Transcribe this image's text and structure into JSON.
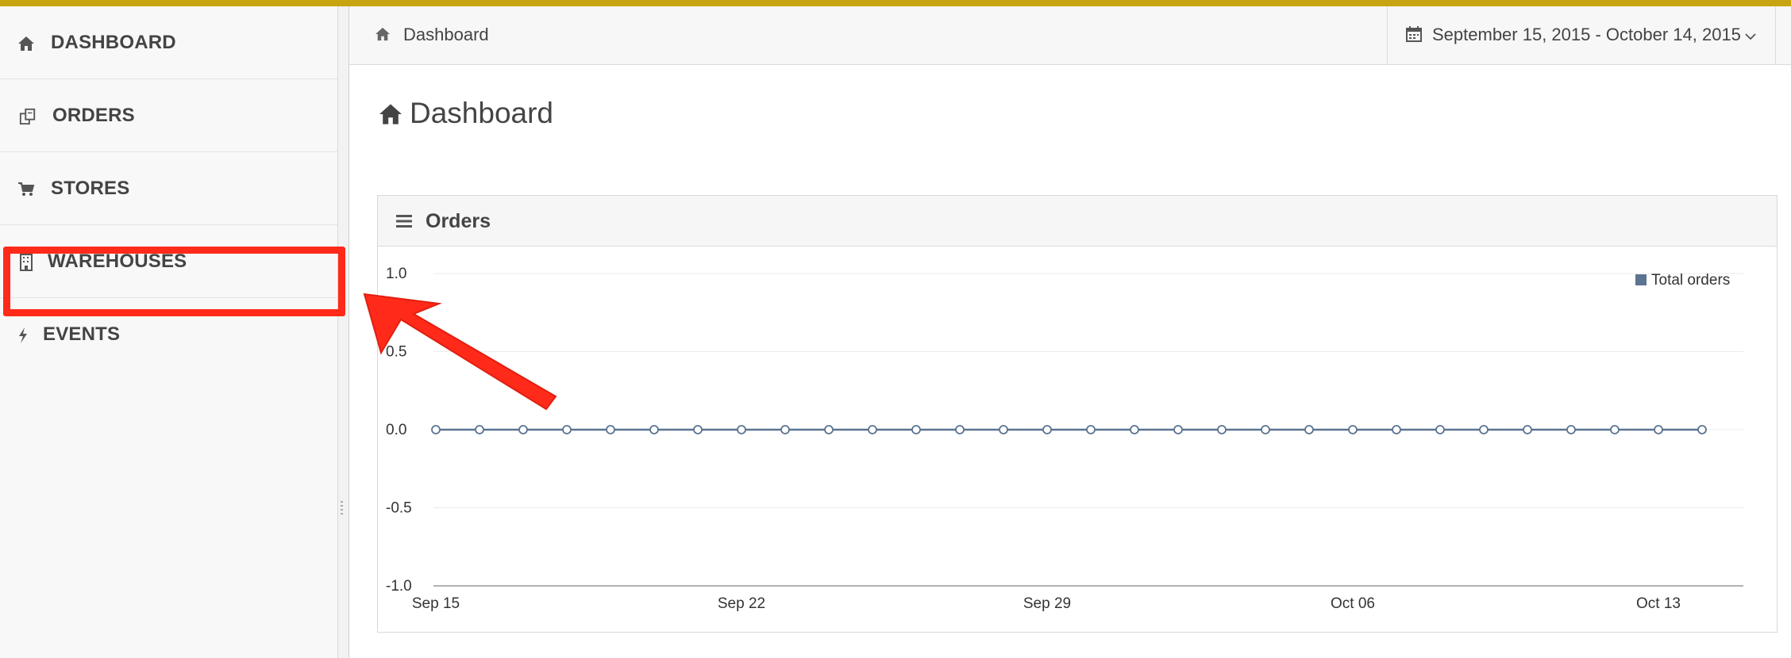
{
  "colors": {
    "top_accent": "#c9a411",
    "annotation": "#ff2a1a",
    "series": "#5b7490"
  },
  "sidebar": {
    "items": [
      {
        "label": "DASHBOARD",
        "icon": "home-icon"
      },
      {
        "label": "ORDERS",
        "icon": "orders-icon"
      },
      {
        "label": "STORES",
        "icon": "cart-icon"
      },
      {
        "label": "WAREHOUSES",
        "icon": "building-icon"
      },
      {
        "label": "EVENTS",
        "icon": "bolt-icon"
      }
    ]
  },
  "header": {
    "breadcrumb": "Dashboard",
    "date_range": "September 15, 2015 - October 14, 2015"
  },
  "page": {
    "title": "Dashboard"
  },
  "panel": {
    "title": "Orders"
  },
  "chart_data": {
    "type": "line",
    "title": "",
    "xlabel": "",
    "ylabel": "",
    "ylim": [
      -1.0,
      1.0
    ],
    "y_ticks": [
      "1.0",
      "0.5",
      "0.0",
      "-0.5",
      "-1.0"
    ],
    "x_tick_labels": [
      "Sep 15",
      "Sep 22",
      "Sep 29",
      "Oct 06",
      "Oct 13"
    ],
    "legend_position": "top-right",
    "grid": true,
    "x": [
      "Sep 15",
      "Sep 16",
      "Sep 17",
      "Sep 18",
      "Sep 19",
      "Sep 20",
      "Sep 21",
      "Sep 22",
      "Sep 23",
      "Sep 24",
      "Sep 25",
      "Sep 26",
      "Sep 27",
      "Sep 28",
      "Sep 29",
      "Sep 30",
      "Oct 01",
      "Oct 02",
      "Oct 03",
      "Oct 04",
      "Oct 05",
      "Oct 06",
      "Oct 07",
      "Oct 08",
      "Oct 09",
      "Oct 10",
      "Oct 11",
      "Oct 12",
      "Oct 13",
      "Oct 14"
    ],
    "series": [
      {
        "name": "Total orders",
        "values": [
          0,
          0,
          0,
          0,
          0,
          0,
          0,
          0,
          0,
          0,
          0,
          0,
          0,
          0,
          0,
          0,
          0,
          0,
          0,
          0,
          0,
          0,
          0,
          0,
          0,
          0,
          0,
          0,
          0,
          0
        ]
      }
    ]
  }
}
